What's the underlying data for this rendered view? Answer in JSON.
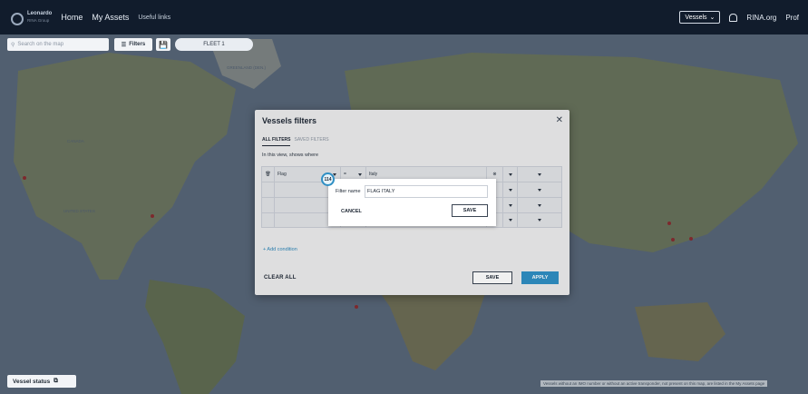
{
  "topbar": {
    "logo_title": "Leonardo",
    "logo_sub": "RINA Group",
    "nav_home": "Home",
    "nav_assets": "My Assets",
    "nav_links": "Useful links",
    "vessels_dropdown": "Vessels",
    "rina_org": "RINA.org",
    "profile": "Prof"
  },
  "map_toolbar": {
    "search_placeholder": "Search on the map",
    "filters_label": "Filters",
    "fleet_label": "FLEET 1"
  },
  "map_labels": {
    "canada": "CANADA",
    "united_states": "UNITED STATES",
    "greenland": "GREENLAND (DEN.)"
  },
  "vessel_status": "Vessel status",
  "map_note": "Vessels without an IMO number or without an active transponder, not present on this map, are listed in the My Assets page",
  "modal": {
    "title": "Vessels filters",
    "tabs": [
      "ALL FILTERS",
      "SAVED FILTERS"
    ],
    "shows_where": "In this view, shows where",
    "conditions": [
      {
        "field": "Flag",
        "operator": "=",
        "value": "Italy"
      },
      {
        "field": "",
        "operator": "",
        "value": ""
      },
      {
        "field": "",
        "operator": "",
        "value": ""
      },
      {
        "field": "",
        "operator": "",
        "value": ""
      }
    ],
    "add_condition": "+ Add condition",
    "clear_all": "CLEAR ALL",
    "save": "SAVE",
    "apply": "APPLY"
  },
  "save_popup": {
    "label": "Filter name",
    "value": "FLAG ITALY",
    "cancel": "CANCEL",
    "save": "SAVE",
    "step_badge": "114"
  }
}
